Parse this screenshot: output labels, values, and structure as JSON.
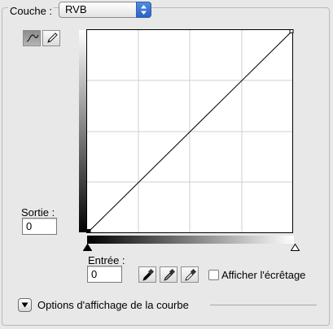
{
  "channel": {
    "label": "Couche :",
    "selected": "RVB"
  },
  "curve_tools": [
    "curve-point-tool",
    "pencil-draw-tool"
  ],
  "output": {
    "label": "Sortie :",
    "value": "0"
  },
  "input": {
    "label": "Entrée :",
    "value": "0"
  },
  "eyedroppers": [
    "black-point-eyedropper",
    "gray-point-eyedropper",
    "white-point-eyedropper"
  ],
  "clipping": {
    "label": "Afficher l'écrêtage",
    "checked": false
  },
  "display_options": {
    "label": "Options d'affichage de la courbe"
  },
  "curve": {
    "points": [
      [
        0,
        0
      ],
      [
        255,
        255
      ]
    ],
    "grid_divisions": 4
  },
  "colors": {
    "window_bg": "#e8e8e8",
    "accent": "#2f6ad1",
    "grid": "#cfcfcf"
  }
}
